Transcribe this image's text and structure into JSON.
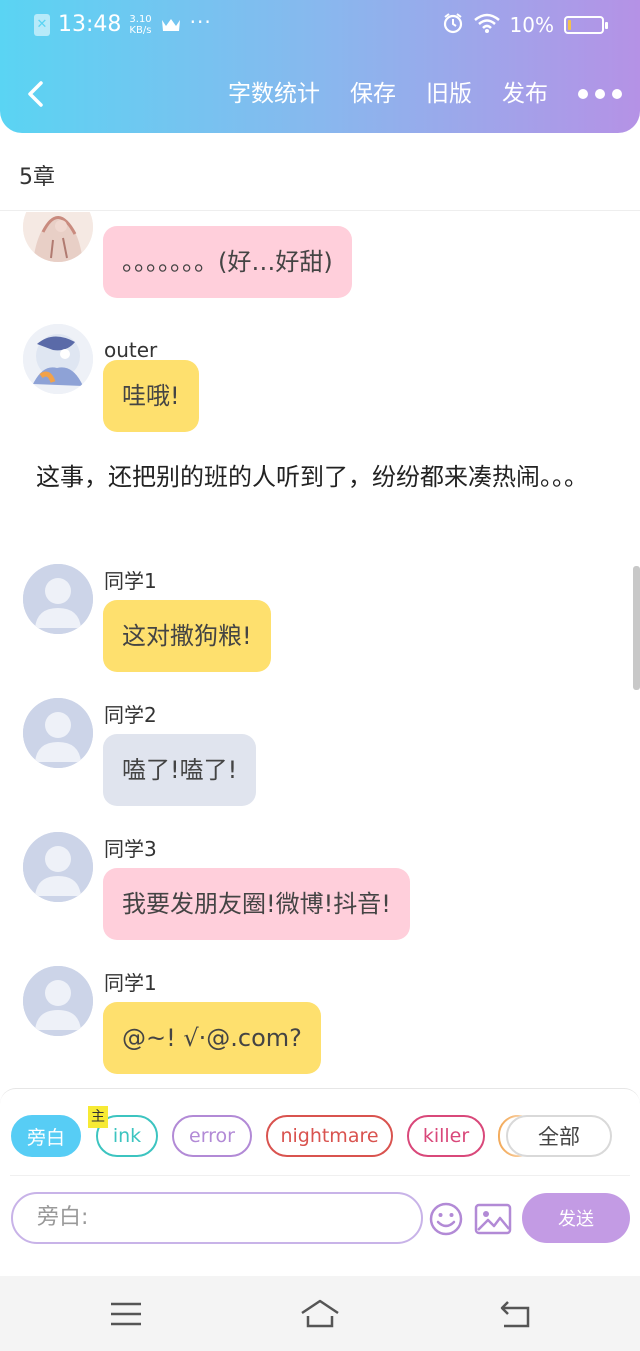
{
  "status_bar": {
    "time": "13:48",
    "speed_value": "3.10",
    "speed_unit": "KB/s",
    "more": "···",
    "battery": "10%",
    "battery_level": 0.1
  },
  "navbar": {
    "actions": [
      "字数统计",
      "保存",
      "旧版",
      "发布"
    ]
  },
  "chapter": {
    "title": "5章"
  },
  "messages": [
    {
      "name": "",
      "avatar": "anime-avatar-1",
      "text": "。。。。。。。(好…好甜)",
      "bubble_color": "#ffcfdb"
    },
    {
      "name": "outer",
      "avatar": "anime-avatar-2",
      "text": "哇哦!",
      "bubble_color": "#fee06e"
    },
    {
      "name": "同学1",
      "avatar": "default-avatar",
      "text": "这对撒狗粮!",
      "bubble_color": "#fee06e"
    },
    {
      "name": "同学2",
      "avatar": "default-avatar",
      "text": "嗑了!嗑了!",
      "bubble_color": "#e0e4ee"
    },
    {
      "name": "同学3",
      "avatar": "default-avatar",
      "text": "我要发朋友圈!微博!抖音!",
      "bubble_color": "#ffcfdb"
    },
    {
      "name": "同学1",
      "avatar": "default-avatar",
      "text": "@~! √·@.com?",
      "bubble_color": "#fee06e"
    }
  ],
  "narration": "这事，还把别的班的人听到了，纷纷都来凑热闹。。。",
  "composer": {
    "roles": [
      {
        "label": "旁白",
        "color": "#57cdf5",
        "active": true
      },
      {
        "label": "ink",
        "color": "#3cc4c0",
        "active": false
      },
      {
        "label": "error",
        "color": "#b28ad6",
        "active": false
      },
      {
        "label": "nightmare",
        "color": "#d9534f",
        "active": false
      },
      {
        "label": "killer",
        "color": "#d9487a",
        "active": false
      }
    ],
    "main_tag": "主",
    "all_label": "全部",
    "placeholder": "旁白:",
    "send_label": "发送"
  },
  "colors": {
    "header_gradient_start": "#5ad4f3",
    "header_gradient_end": "#b592e6",
    "send_button": "#c39be4",
    "input_border": "#c8b3e8"
  },
  "icons": {
    "back": "chevron-left-icon",
    "more": "more-dots-icon",
    "emoji": "smiley-icon",
    "image": "image-icon",
    "menu": "menu-icon",
    "home": "home-icon",
    "return": "back-arrow-icon"
  }
}
